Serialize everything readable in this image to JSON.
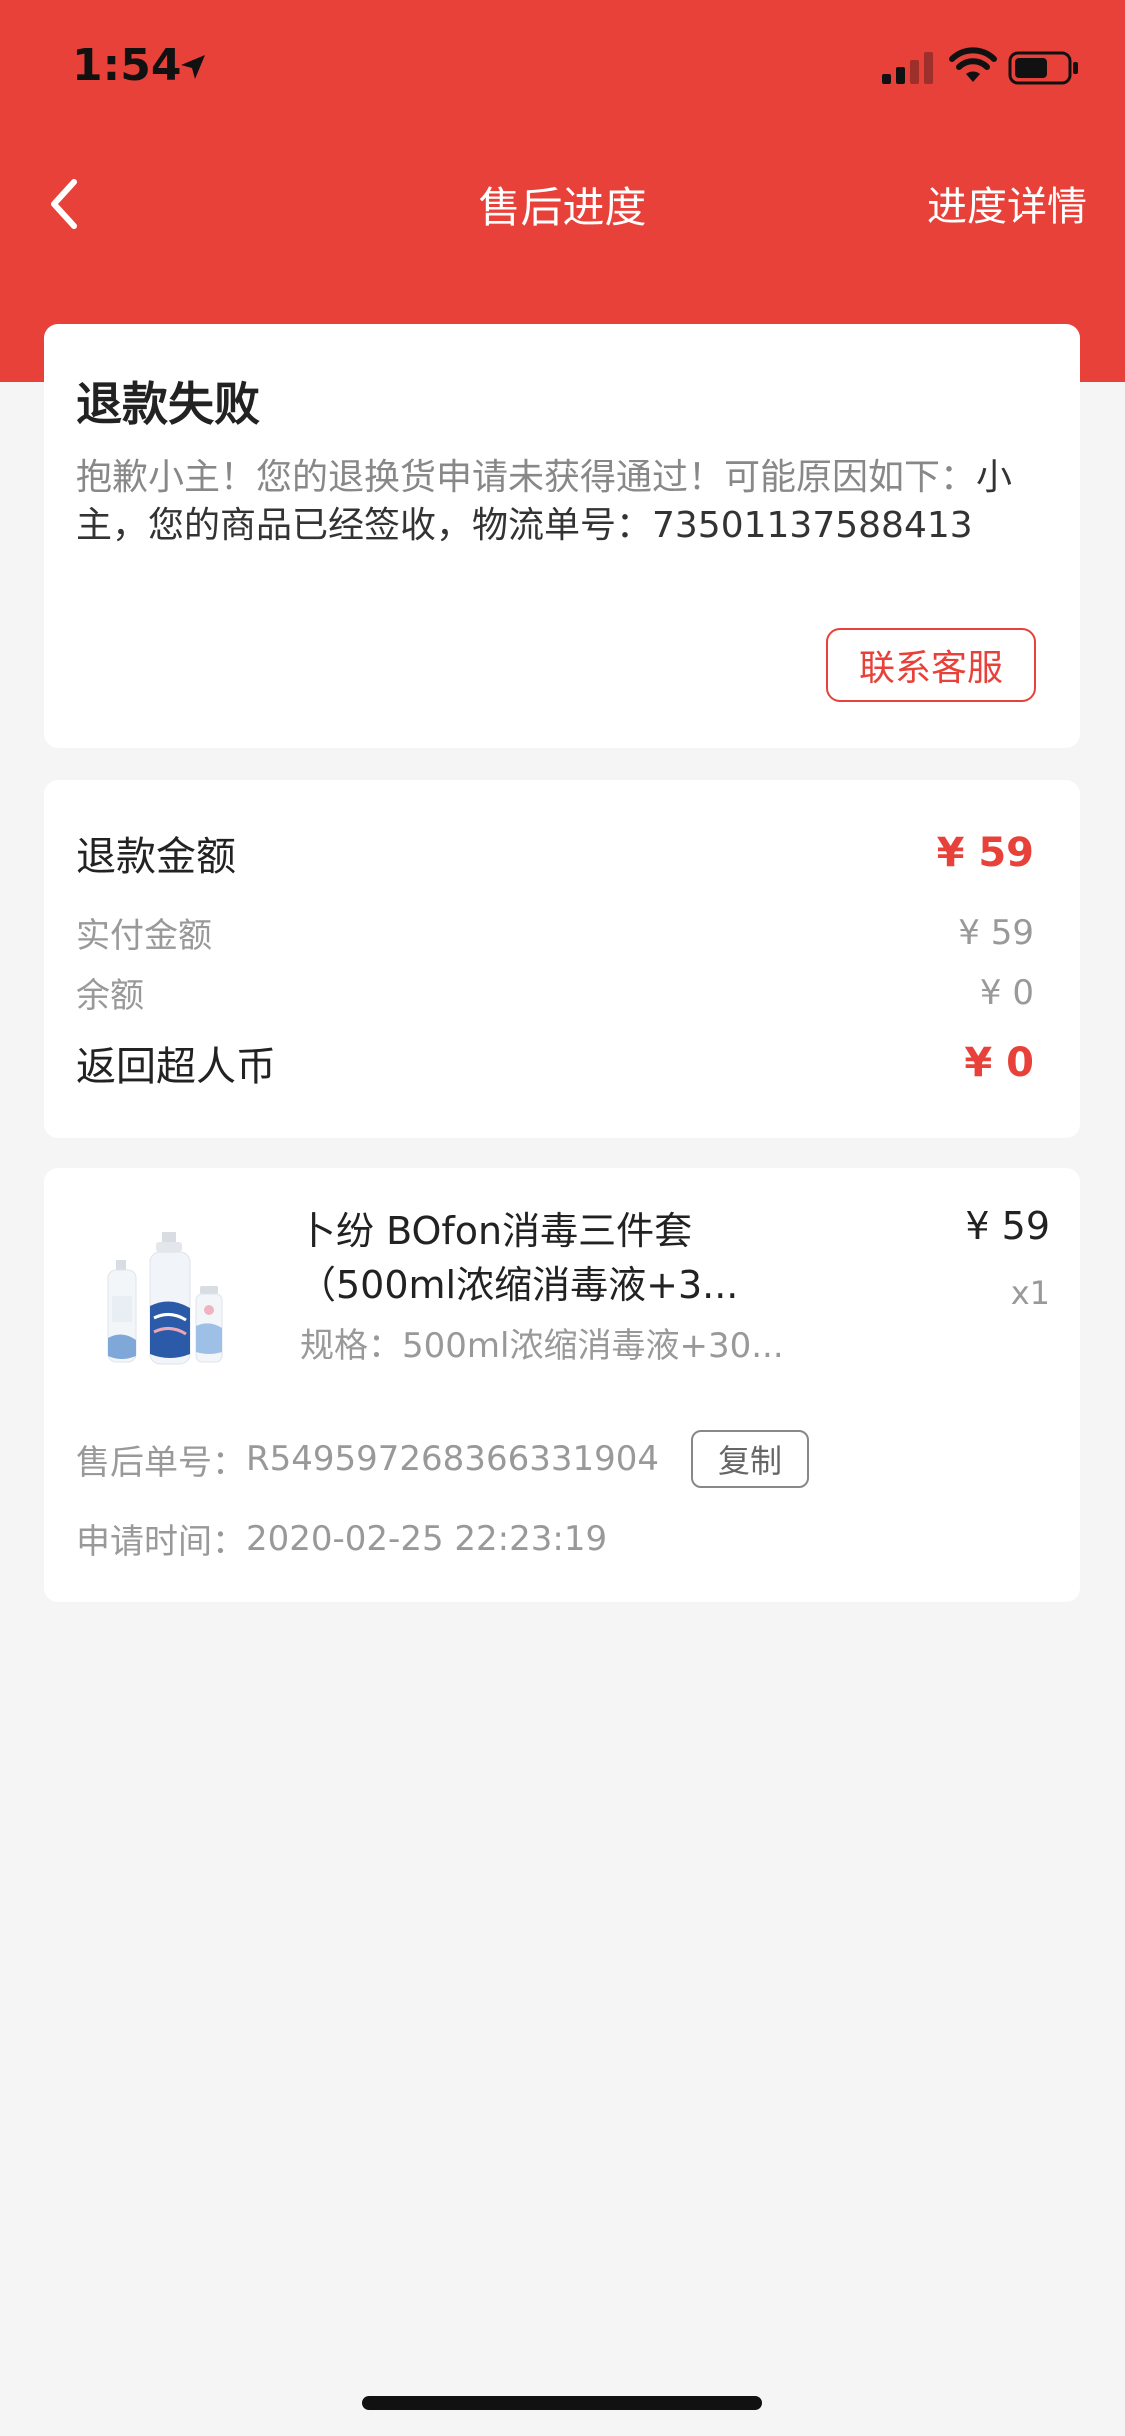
{
  "status_bar": {
    "time": "1:54"
  },
  "nav": {
    "title": "售后进度",
    "right_link": "进度详情"
  },
  "refund_status": {
    "title": "退款失败",
    "desc_gray": "抱歉小主！您的退换货申请未获得通过！可能原因如下：",
    "desc_dark": "小主，您的商品已经签收，物流单号：73501137588413",
    "contact_label": "联系客服"
  },
  "amounts": [
    {
      "label": "退款金额",
      "value": "¥ 59",
      "style": "big"
    },
    {
      "label": "实付金额",
      "value": "¥ 59",
      "style": "small"
    },
    {
      "label": "余额",
      "value": "¥ 0",
      "style": "small"
    },
    {
      "label": "返回超人币",
      "value": "¥ 0",
      "style": "big"
    }
  ],
  "product": {
    "title": "卜纷 BOfon消毒三件套（500ml浓缩消毒液+3...",
    "spec": "规格：500ml浓缩消毒液+30...",
    "price": "¥ 59",
    "qty": "x1"
  },
  "aftersale": {
    "order_label": "售后单号：",
    "order_no": "R549597268366331904",
    "copy_label": "复制",
    "time_label": "申请时间：",
    "time_value": "2020-02-25 22:23:19"
  },
  "colors": {
    "brand": "#e8413a",
    "background": "#f5f5f5"
  }
}
